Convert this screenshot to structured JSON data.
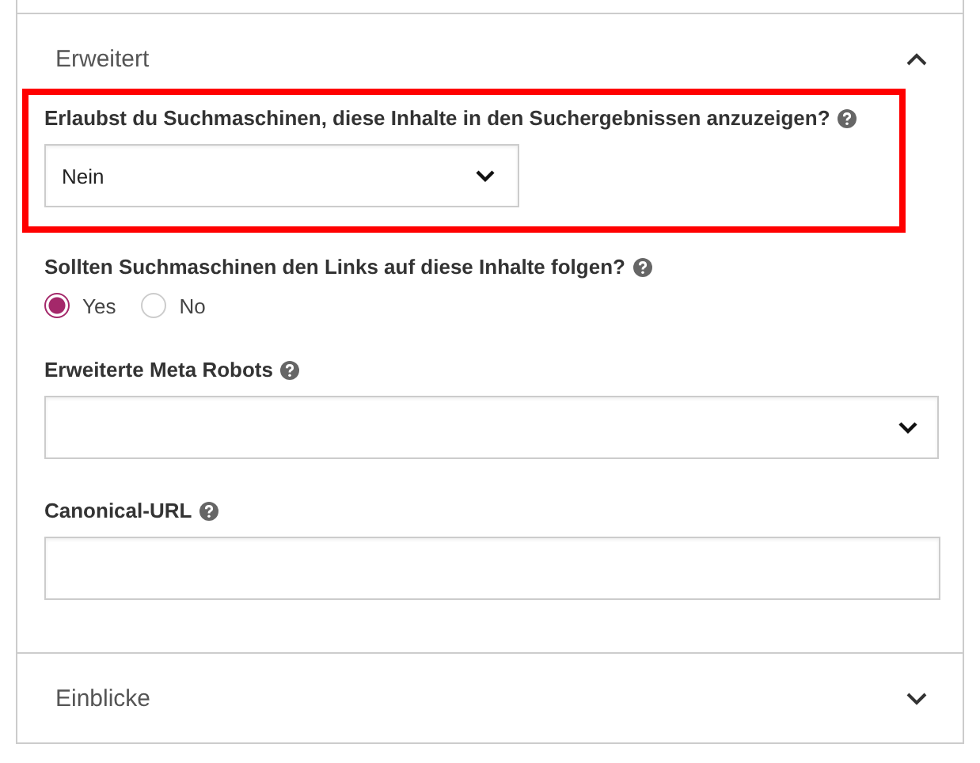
{
  "sections": [
    {
      "title": "Erweitert",
      "expanded": true,
      "fields": [
        {
          "kind": "select",
          "label": "Erlaubst du Suchmaschinen, diese Inhalte in den Suchergebnissen anzuzeigen?",
          "value": "Nein",
          "highlighted": true,
          "wide": false
        },
        {
          "kind": "radio",
          "label": "Sollten Suchmaschinen den Links auf diese Inhalte folgen?",
          "options": [
            {
              "label": "Yes",
              "selected": true
            },
            {
              "label": "No",
              "selected": false
            }
          ]
        },
        {
          "kind": "select",
          "label": "Erweiterte Meta Robots",
          "wide": true
        },
        {
          "kind": "text",
          "label": "Canonical-URL"
        }
      ]
    },
    {
      "title": "Einblicke",
      "expanded": false
    }
  ]
}
